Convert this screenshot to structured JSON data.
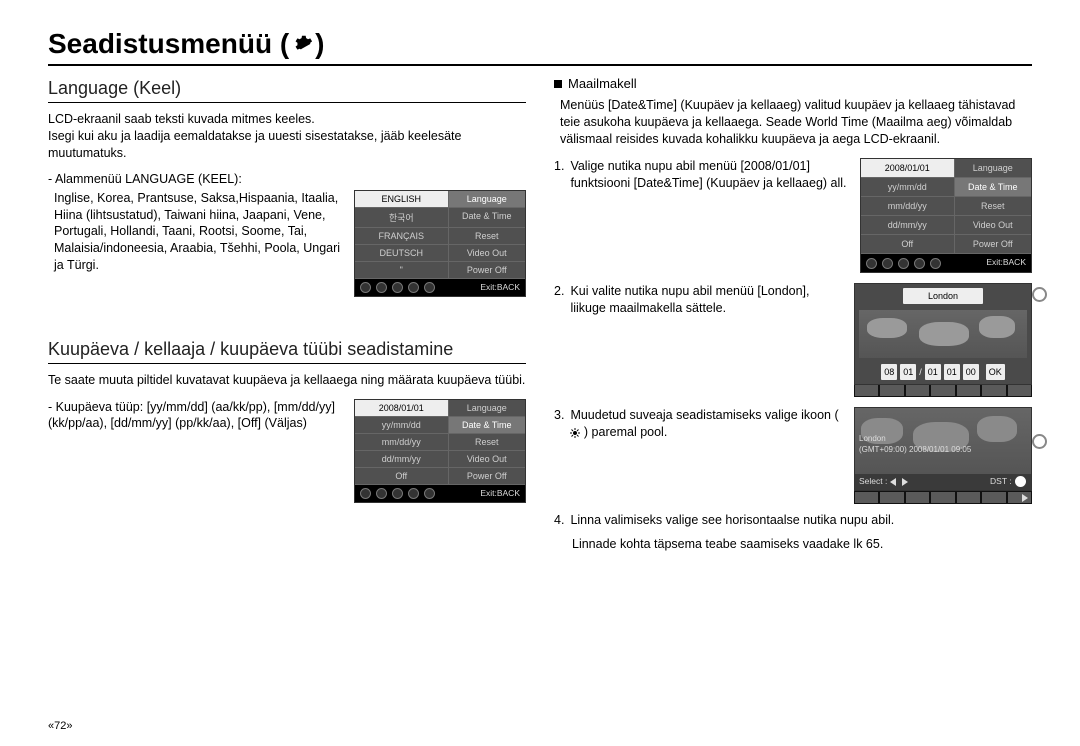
{
  "page_number": "«72»",
  "main_title": "Seadistusmenüü (",
  "main_title_close": ")",
  "gear_icon_name": "gear-icon",
  "left": {
    "language": {
      "heading": "Language (Keel)",
      "intro": "LCD-ekraanil saab teksti kuvada mitmes keeles.\nIsegi kui aku ja laadija eemaldatakse ja uuesti sisestatakse, jääb keelesäte muutumatuks.",
      "submenu_label": "- Alammenüü LANGUAGE (KEEL):",
      "submenu_body": "Inglise, Korea, Prantsuse, Saksa,Hispaania, Itaalia, Hiina (lihtsustatud), Taiwani hiina, Jaapani, Vene, Portugali, Hollandi, Taani, Rootsi, Soome, Tai, Malaisia/indoneesia, Araabia, Tšehhi, Poola, Ungari ja Türgi.",
      "menu": {
        "left": [
          "ENGLISH",
          "한국어",
          "FRANÇAIS",
          "DEUTSCH",
          "\""
        ],
        "right": [
          "Language",
          "Date & Time",
          "Reset",
          "Video Out",
          "Power Off"
        ],
        "exit": "Exit:BACK"
      }
    },
    "date": {
      "heading": "Kuupäeva / kellaaja / kuupäeva tüübi seadistamine",
      "intro": "Te saate muuta piltidel kuvatavat kuupäeva ja kellaaega ning määrata kuupäeva tüübi.",
      "type_label": "- Kuupäeva tüüp:",
      "type_values": "[yy/mm/dd] (aa/kk/pp), [mm/dd/yy] (kk/pp/aa), [dd/mm/yy] (pp/kk/aa), [Off] (Väljas)",
      "menu": {
        "left": [
          "2008/01/01",
          "yy/mm/dd",
          "mm/dd/yy",
          "dd/mm/yy",
          "Off"
        ],
        "right": [
          "Language",
          "Date & Time",
          "Reset",
          "Video Out",
          "Power Off"
        ],
        "exit": "Exit:BACK"
      }
    }
  },
  "right": {
    "worldclock": {
      "bullet_title": "Maailmakell",
      "intro": "Menüüs [Date&Time] (Kuupäev ja kellaaeg) valitud kuupäev ja kellaaeg tähistavad teie asukoha kuupäeva ja kellaaega. Seade World Time (Maailma aeg) võimaldab välismaal reisides kuvada kohalikku kuupäeva ja aega LCD-ekraanil.",
      "steps": [
        {
          "n": "1.",
          "text": "Valige nutika nupu abil menüü [2008/01/01] funktsiooni [Date&Time] (Kuupäev ja kellaaeg) all."
        },
        {
          "n": "2.",
          "text": "Kui valite nutika nupu abil menüü [London], liikuge maailmakella sättele."
        },
        {
          "n": "3.",
          "text_pre": "Muudetud suveaja seadistamiseks valige ikoon (",
          "text_post": ") paremal pool."
        },
        {
          "n": "4.",
          "text": "Linna valimiseks valige see horisontaalse nutika nupu abil."
        }
      ],
      "more_info": "Linnade kohta täpsema teabe saamiseks vaadake lk 65.",
      "menu": {
        "left": [
          "2008/01/01",
          "yy/mm/dd",
          "mm/dd/yy",
          "dd/mm/yy",
          "Off"
        ],
        "right": [
          "Language",
          "Date & Time",
          "Reset",
          "Video Out",
          "Power Off"
        ],
        "exit": "Exit:BACK"
      },
      "world_widget": {
        "city": "London",
        "segments": [
          "08",
          "01",
          "/",
          "01",
          "01",
          "00"
        ],
        "ok": "OK"
      },
      "world_widget2": {
        "city": "London",
        "info": "(GMT+09:00) 2008/01/01 09:05",
        "select_label": "Select :",
        "dst_label": "DST :"
      }
    }
  }
}
